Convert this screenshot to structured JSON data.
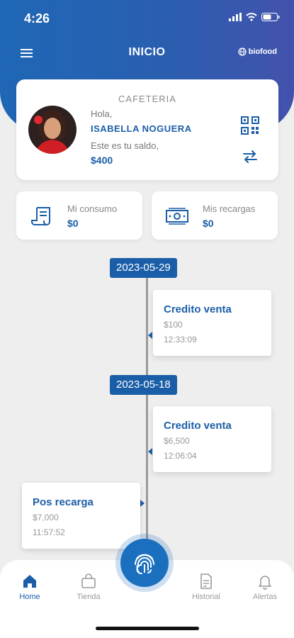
{
  "status_bar": {
    "time": "4:26"
  },
  "header": {
    "title": "INICIO",
    "brand": "biofood"
  },
  "profile": {
    "section_label": "CAFETERIA",
    "greeting": "Hola,",
    "name": "ISABELLA NOGUERA",
    "balance_label": "Este es tu saldo,",
    "balance": "$400"
  },
  "stats": [
    {
      "label": "Mi consumo",
      "value": "$0",
      "icon": "receipt-icon"
    },
    {
      "label": "Mis recargas",
      "value": "$0",
      "icon": "banknote-icon"
    }
  ],
  "timeline": {
    "dates": [
      "2023-05-29",
      "2023-05-18"
    ],
    "entries": [
      {
        "title": "Credito venta",
        "amount": "$100",
        "time": "12:33:09"
      },
      {
        "title": "Credito venta",
        "amount": "$6,500",
        "time": "12:06:04"
      },
      {
        "title": "Pos recarga",
        "amount": "$7,000",
        "time": "11:57:52"
      }
    ]
  },
  "bottom_nav": {
    "items": [
      {
        "label": "Home",
        "icon": "home-icon",
        "active": true
      },
      {
        "label": "Tienda",
        "icon": "bag-icon",
        "active": false
      },
      {
        "label": "Historial",
        "icon": "document-icon",
        "active": false
      },
      {
        "label": "Alertas",
        "icon": "bell-icon",
        "active": false
      }
    ],
    "fab_icon": "fingerprint-icon"
  },
  "colors": {
    "primary": "#1b5ea8",
    "header_gradient_start": "#1f67b6",
    "header_gradient_end": "#4352ac",
    "background": "#eeeeee",
    "muted_text": "#999999"
  }
}
